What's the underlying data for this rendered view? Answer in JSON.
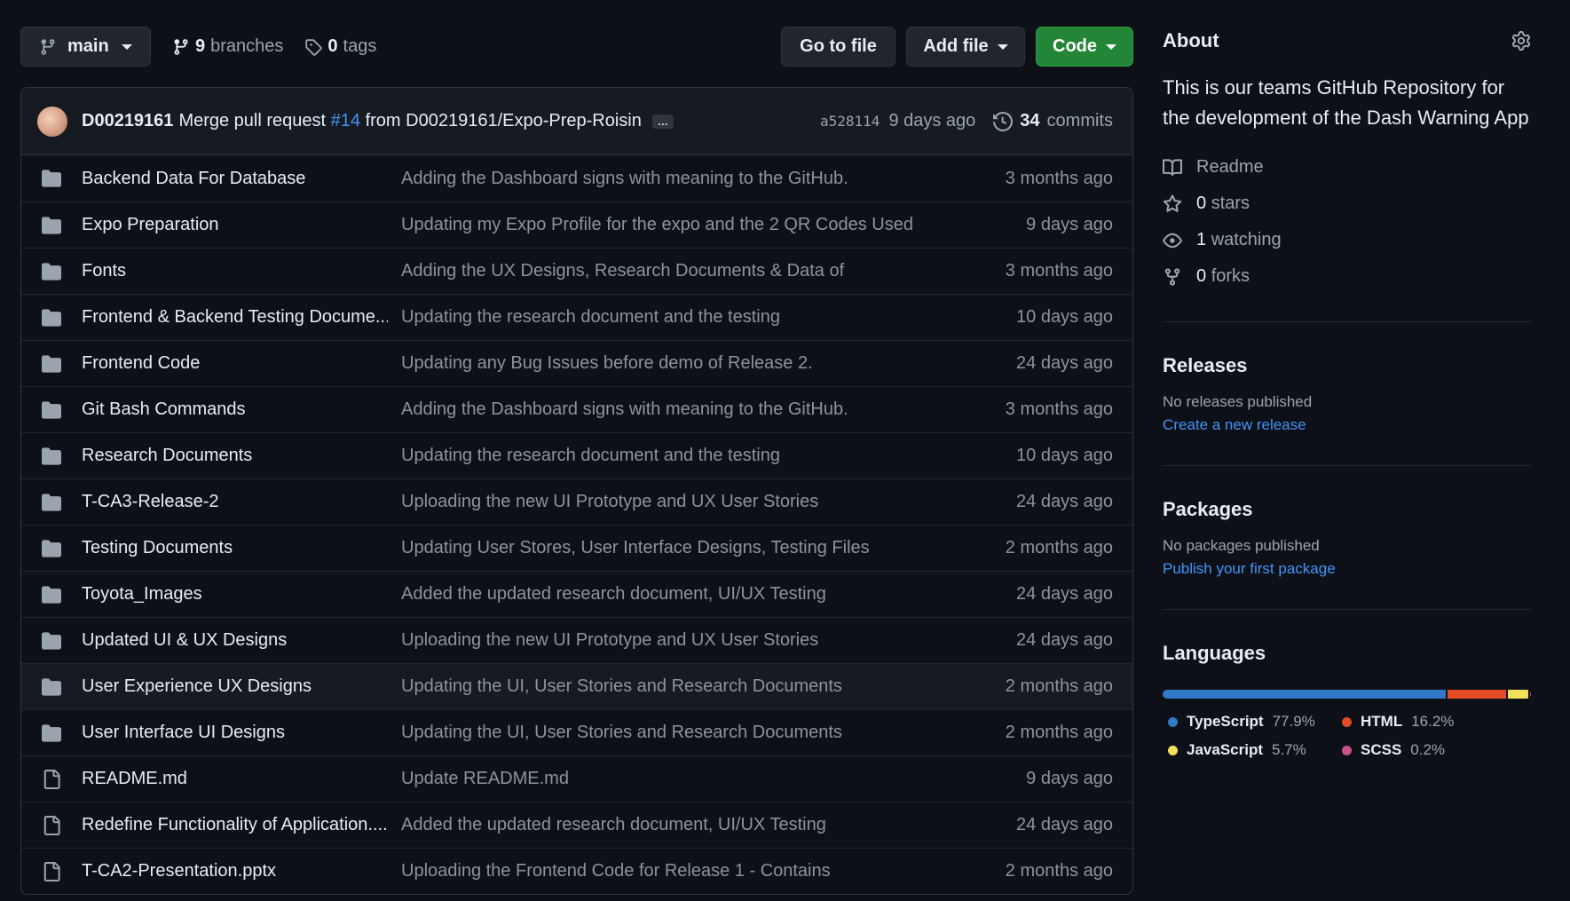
{
  "toolbar": {
    "branch": "main",
    "branches_count": "9",
    "branches_label": "branches",
    "tags_count": "0",
    "tags_label": "tags",
    "goto_file": "Go to file",
    "add_file": "Add file",
    "code": "Code"
  },
  "commit": {
    "author": "D00219161",
    "message_prefix": "Merge pull request",
    "pr": "#14",
    "message_suffix": "from D00219161/Expo-Prep-Roisin",
    "ellipsis": "…",
    "sha": "a528114",
    "age": "9 days ago",
    "commits_count": "34",
    "commits_label": "commits"
  },
  "files": [
    {
      "type": "dir",
      "name": "Backend Data For Database",
      "message": "Adding the Dashboard signs with meaning to the GitHub.",
      "age": "3 months ago"
    },
    {
      "type": "dir",
      "name": "Expo Preparation",
      "message": "Updating my Expo Profile for the expo and the 2 QR Codes Used",
      "age": "9 days ago"
    },
    {
      "type": "dir",
      "name": "Fonts",
      "message": "Adding the UX Designs, Research Documents & Data of",
      "age": "3 months ago"
    },
    {
      "type": "dir",
      "name": "Frontend & Backend Testing Docume...",
      "message": "Updating the research document and the testing",
      "age": "10 days ago"
    },
    {
      "type": "dir",
      "name": "Frontend Code",
      "message": "Updating any Bug Issues before demo of Release 2.",
      "age": "24 days ago"
    },
    {
      "type": "dir",
      "name": "Git Bash Commands",
      "message": "Adding the Dashboard signs with meaning to the GitHub.",
      "age": "3 months ago"
    },
    {
      "type": "dir",
      "name": "Research Documents",
      "message": "Updating the research document and the testing",
      "age": "10 days ago"
    },
    {
      "type": "dir",
      "name": "T-CA3-Release-2",
      "message": "Uploading the new UI Prototype and UX User Stories",
      "age": "24 days ago"
    },
    {
      "type": "dir",
      "name": "Testing Documents",
      "message": "Updating User Stores, User Interface Designs, Testing Files",
      "age": "2 months ago"
    },
    {
      "type": "dir",
      "name": "Toyota_Images",
      "message": "Added the updated research document, UI/UX Testing",
      "age": "24 days ago"
    },
    {
      "type": "dir",
      "name": "Updated UI & UX Designs",
      "message": "Uploading the new UI Prototype and UX User Stories",
      "age": "24 days ago"
    },
    {
      "type": "dir",
      "name": "User Experience UX Designs",
      "message": "Updating the UI, User Stories and Research Documents",
      "age": "2 months ago"
    },
    {
      "type": "dir",
      "name": "User Interface UI Designs",
      "message": "Updating the UI, User Stories and Research Documents",
      "age": "2 months ago"
    },
    {
      "type": "file",
      "name": "README.md",
      "message": "Update README.md",
      "age": "9 days ago"
    },
    {
      "type": "file",
      "name": "Redefine Functionality of Application....",
      "message": "Added the updated research document, UI/UX Testing",
      "age": "24 days ago"
    },
    {
      "type": "file",
      "name": "T-CA2-Presentation.pptx",
      "message": "Uploading the Frontend Code for Release 1 - Contains",
      "age": "2 months ago"
    }
  ],
  "about": {
    "title": "About",
    "description": "This is our teams GitHub Repository for the development of the Dash Warning App",
    "readme": "Readme",
    "stars_count": "0",
    "stars_label": "stars",
    "watching_count": "1",
    "watching_label": "watching",
    "forks_count": "0",
    "forks_label": "forks"
  },
  "releases": {
    "title": "Releases",
    "empty": "No releases published",
    "link": "Create a new release"
  },
  "packages": {
    "title": "Packages",
    "empty": "No packages published",
    "link": "Publish your first package"
  },
  "languages": {
    "title": "Languages",
    "items": [
      {
        "name": "TypeScript",
        "pct": "77.9%",
        "value": 77.9,
        "color": "#3178c6"
      },
      {
        "name": "HTML",
        "pct": "16.2%",
        "value": 16.2,
        "color": "#e34c26"
      },
      {
        "name": "JavaScript",
        "pct": "5.7%",
        "value": 5.7,
        "color": "#f1e05a"
      },
      {
        "name": "SCSS",
        "pct": "0.2%",
        "value": 0.2,
        "color": "#c6538c"
      }
    ]
  }
}
